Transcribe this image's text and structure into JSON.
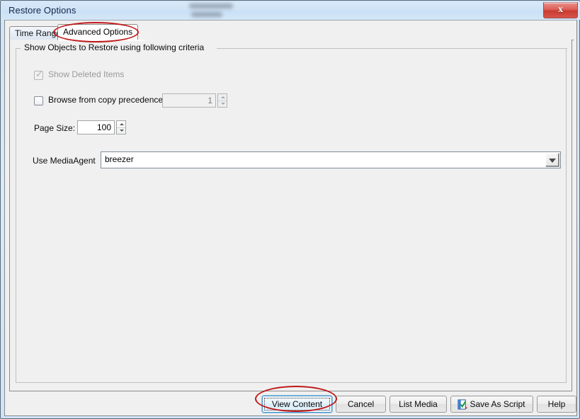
{
  "window": {
    "title": "Restore Options",
    "close_label": "x",
    "redacted_note": "blurred text"
  },
  "tabs": [
    {
      "label": "Time Range",
      "active": false
    },
    {
      "label": "Advanced Options",
      "active": true
    }
  ],
  "group": {
    "title": "Show Objects to Restore using following criteria"
  },
  "fields": {
    "show_deleted_items": {
      "label": "Show Deleted Items",
      "checked": true,
      "enabled": false,
      "tick": "✓"
    },
    "browse_copy_precedence": {
      "label": "Browse from copy precedence:",
      "checked": false,
      "enabled": true,
      "value": "1",
      "spinner_enabled": false
    },
    "page_size": {
      "label": "Page Size:",
      "value": "100",
      "spinner_enabled": true
    },
    "use_mediaagent": {
      "label": "Use MediaAgent",
      "value": "breezer"
    }
  },
  "buttons": [
    {
      "label": "View Content",
      "focused": true,
      "icon": null
    },
    {
      "label": "Cancel",
      "focused": false,
      "icon": null
    },
    {
      "label": "List Media",
      "focused": false,
      "icon": null
    },
    {
      "label": "Save As Script",
      "focused": false,
      "icon": "script-icon"
    },
    {
      "label": "Help",
      "focused": false,
      "icon": null
    }
  ],
  "colors": {
    "titlebar": "#d3e4f6",
    "close_button": "#d8534a",
    "client_background": "#f0f0f0",
    "annotation": "#c01818",
    "focus_accent": "#4a90c4"
  }
}
